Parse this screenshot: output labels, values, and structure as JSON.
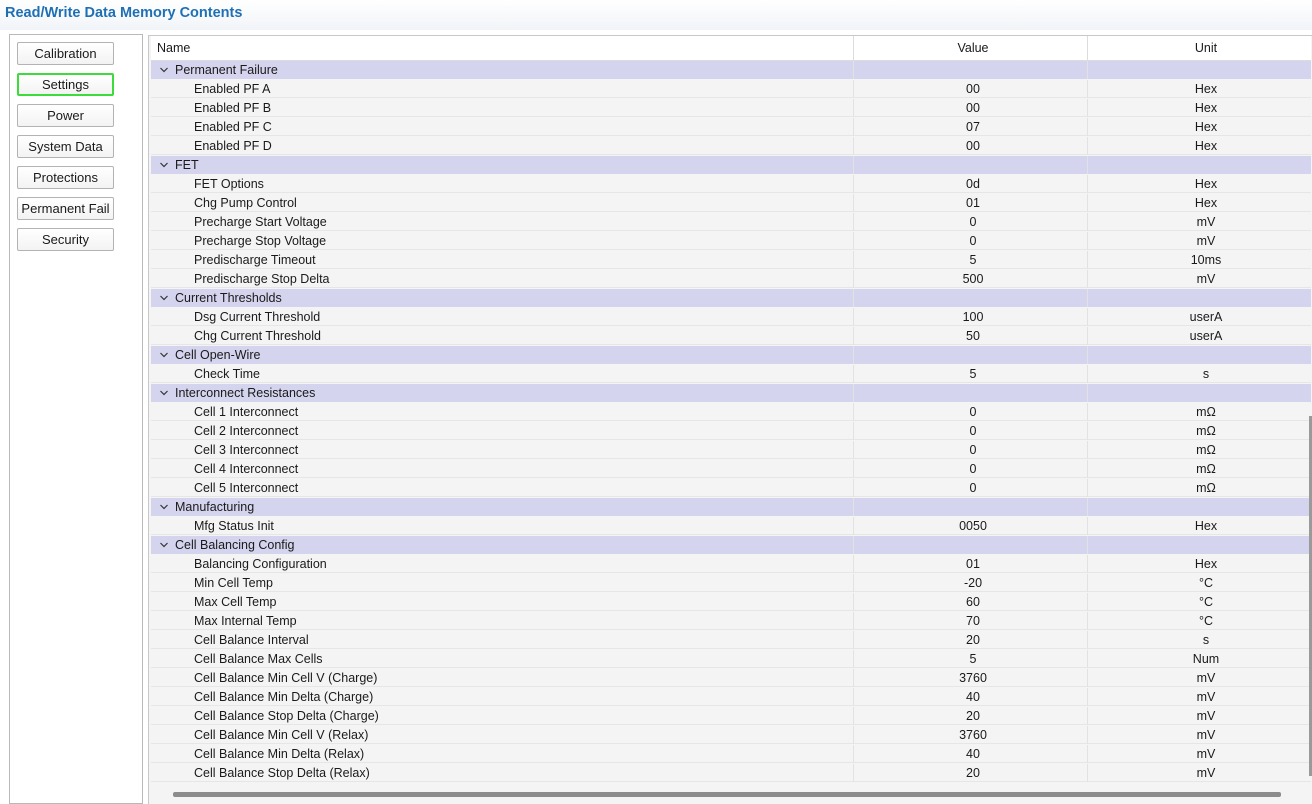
{
  "window": {
    "title": "Read/Write Data Memory Contents"
  },
  "sidebar": {
    "buttons": [
      {
        "label": "Calibration"
      },
      {
        "label": "Settings"
      },
      {
        "label": "Power"
      },
      {
        "label": "System Data"
      },
      {
        "label": "Protections"
      },
      {
        "label": "Permanent Fail"
      },
      {
        "label": "Security"
      }
    ],
    "active": "Settings",
    "active_border_color": "#3ddc3d"
  },
  "table": {
    "columns": {
      "name": "Name",
      "value": "Value",
      "unit": "Unit"
    },
    "group_row_color": "#d4d4ee",
    "groups": [
      {
        "name": "Permanent Failure",
        "rows": [
          {
            "name": "Enabled PF A",
            "value": "00",
            "unit": "Hex"
          },
          {
            "name": "Enabled PF B",
            "value": "00",
            "unit": "Hex"
          },
          {
            "name": "Enabled PF C",
            "value": "07",
            "unit": "Hex"
          },
          {
            "name": "Enabled PF D",
            "value": "00",
            "unit": "Hex"
          }
        ]
      },
      {
        "name": "FET",
        "rows": [
          {
            "name": "FET Options",
            "value": "0d",
            "unit": "Hex"
          },
          {
            "name": "Chg Pump Control",
            "value": "01",
            "unit": "Hex"
          },
          {
            "name": "Precharge Start Voltage",
            "value": "0",
            "unit": "mV"
          },
          {
            "name": "Precharge Stop Voltage",
            "value": "0",
            "unit": "mV"
          },
          {
            "name": "Predischarge Timeout",
            "value": "5",
            "unit": "10ms"
          },
          {
            "name": "Predischarge Stop Delta",
            "value": "500",
            "unit": "mV"
          }
        ]
      },
      {
        "name": "Current Thresholds",
        "rows": [
          {
            "name": "Dsg Current Threshold",
            "value": "100",
            "unit": "userA"
          },
          {
            "name": "Chg Current Threshold",
            "value": "50",
            "unit": "userA"
          }
        ]
      },
      {
        "name": "Cell Open-Wire",
        "rows": [
          {
            "name": "Check Time",
            "value": "5",
            "unit": "s"
          }
        ]
      },
      {
        "name": "Interconnect Resistances",
        "rows": [
          {
            "name": "Cell 1 Interconnect",
            "value": "0",
            "unit": "mΩ"
          },
          {
            "name": "Cell 2 Interconnect",
            "value": "0",
            "unit": "mΩ"
          },
          {
            "name": "Cell 3 Interconnect",
            "value": "0",
            "unit": "mΩ"
          },
          {
            "name": "Cell 4 Interconnect",
            "value": "0",
            "unit": "mΩ"
          },
          {
            "name": "Cell 5 Interconnect",
            "value": "0",
            "unit": "mΩ"
          }
        ]
      },
      {
        "name": "Manufacturing",
        "rows": [
          {
            "name": "Mfg Status Init",
            "value": "0050",
            "unit": "Hex"
          }
        ]
      },
      {
        "name": "Cell Balancing Config",
        "rows": [
          {
            "name": "Balancing Configuration",
            "value": "01",
            "unit": "Hex"
          },
          {
            "name": "Min Cell Temp",
            "value": "-20",
            "unit": "°C"
          },
          {
            "name": "Max Cell Temp",
            "value": "60",
            "unit": "°C"
          },
          {
            "name": "Max Internal Temp",
            "value": "70",
            "unit": "°C"
          },
          {
            "name": "Cell Balance Interval",
            "value": "20",
            "unit": "s"
          },
          {
            "name": "Cell Balance Max Cells",
            "value": "5",
            "unit": "Num"
          },
          {
            "name": "Cell Balance Min Cell V (Charge)",
            "value": "3760",
            "unit": "mV"
          },
          {
            "name": "Cell Balance Min Delta (Charge)",
            "value": "40",
            "unit": "mV"
          },
          {
            "name": "Cell Balance Stop Delta (Charge)",
            "value": "20",
            "unit": "mV"
          },
          {
            "name": "Cell Balance Min Cell V (Relax)",
            "value": "3760",
            "unit": "mV"
          },
          {
            "name": "Cell Balance Min Delta (Relax)",
            "value": "40",
            "unit": "mV"
          },
          {
            "name": "Cell Balance Stop Delta (Relax)",
            "value": "20",
            "unit": "mV"
          }
        ]
      }
    ]
  },
  "icons": {
    "group_toggle": "chevron-down-icon"
  }
}
